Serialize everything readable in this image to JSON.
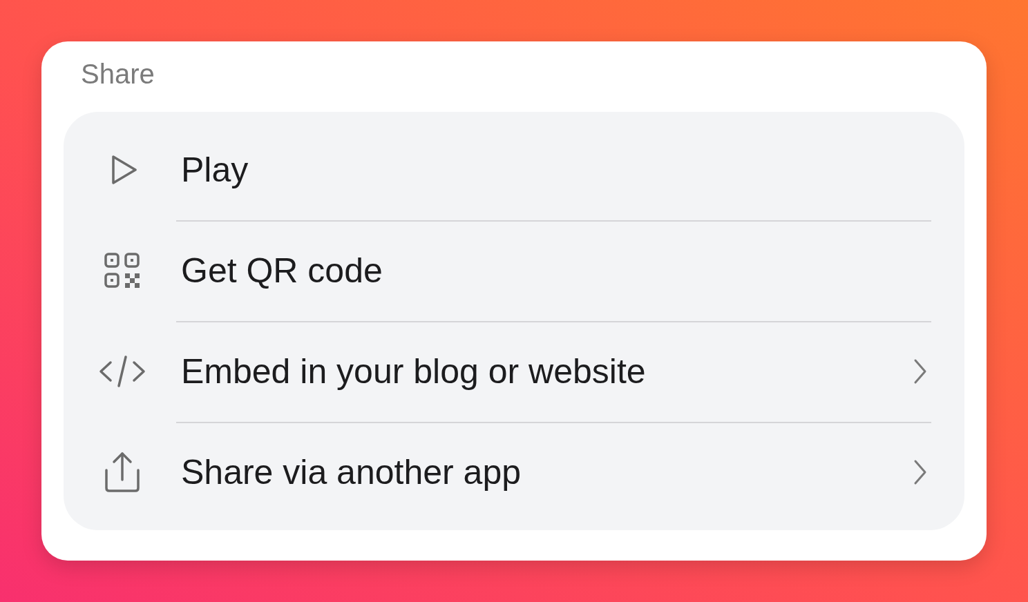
{
  "title": "Share",
  "items": [
    {
      "kind": "play",
      "label": "Play",
      "chevron": false
    },
    {
      "kind": "qr",
      "label": "Get QR code",
      "chevron": false
    },
    {
      "kind": "code",
      "label": "Embed in your blog or website",
      "chevron": true
    },
    {
      "kind": "upload",
      "label": "Share via another app",
      "chevron": true
    }
  ]
}
